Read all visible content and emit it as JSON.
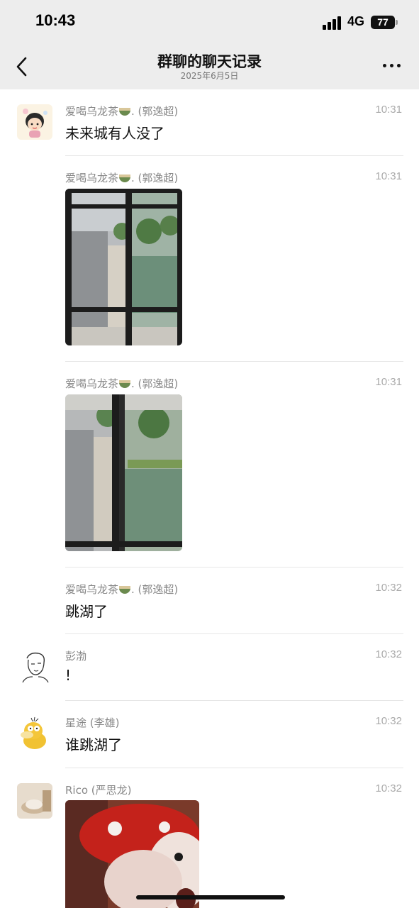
{
  "status_bar": {
    "time": "10:43",
    "network": "4G",
    "battery": "77"
  },
  "nav": {
    "title": "群聊的聊天记录",
    "date": "2025年6月5日"
  },
  "messages": [
    {
      "sender": "爱喝乌龙茶",
      "sender_suffix": ". (郭逸超)",
      "time": "10:31",
      "text": "未来城有人没了"
    },
    {
      "sender": "爱喝乌龙茶",
      "sender_suffix": ". (郭逸超)",
      "time": "10:31"
    },
    {
      "sender": "爱喝乌龙茶",
      "sender_suffix": ". (郭逸超)",
      "time": "10:31"
    },
    {
      "sender": "爱喝乌龙茶",
      "sender_suffix": ". (郭逸超)",
      "time": "10:32",
      "text": "跳湖了"
    },
    {
      "sender": "彭渤",
      "time": "10:32",
      "text": "!"
    },
    {
      "sender": "星途 (李雄)",
      "time": "10:32",
      "text": "谁跳湖了"
    },
    {
      "sender": "Rico (严思龙)",
      "time": "10:32"
    }
  ]
}
